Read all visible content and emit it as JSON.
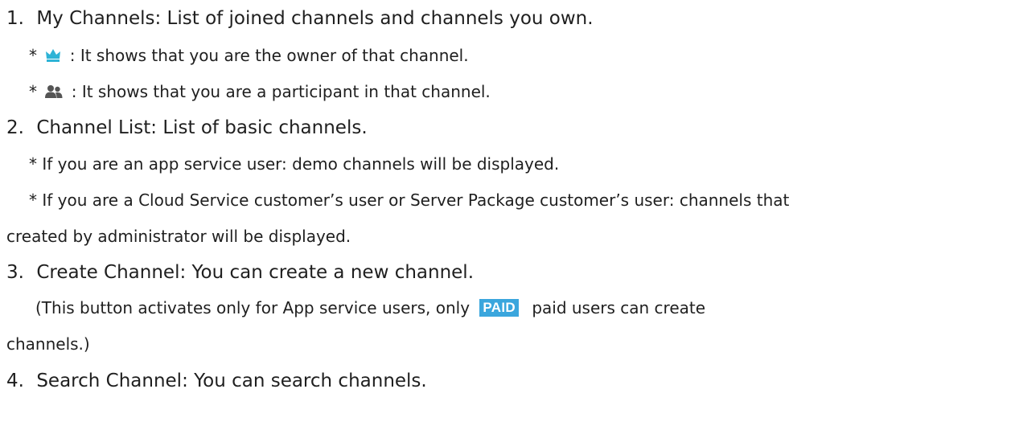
{
  "items": [
    {
      "number": "1.",
      "text": "My Channels: List of joined channels and channels you own.",
      "notes": [
        {
          "bullet": "*",
          "icon": "crown-icon",
          "text": ": It shows that you are the owner of that channel."
        },
        {
          "bullet": "*",
          "icon": "participants-icon",
          "text": ": It shows that you are a participant in that channel."
        }
      ]
    },
    {
      "number": "2.",
      "text": "Channel List: List of basic channels.",
      "notes": [
        {
          "bullet": "*",
          "text": "If you are an app service user: demo channels will be displayed."
        },
        {
          "bullet": "*",
          "text": "If you are a Cloud Service customer’s user or Server Package customer’s user: channels that",
          "continuation": "created by administrator will be displayed."
        }
      ]
    },
    {
      "number": "3.",
      "text": "Create Channel: You can create a new channel.",
      "paren_before": "(This button activates only for App service users, only",
      "badge": "PAID",
      "paren_after": "paid users can create",
      "paren_continuation": "channels.)"
    },
    {
      "number": "4.",
      "text": "Search Channel: You can search channels."
    }
  ],
  "colors": {
    "text": "#1f1f1f",
    "crown": "#2eb3d6",
    "participants": "#555555",
    "badge_bg": "#3aa6dd",
    "badge_text": "#ffffff"
  }
}
